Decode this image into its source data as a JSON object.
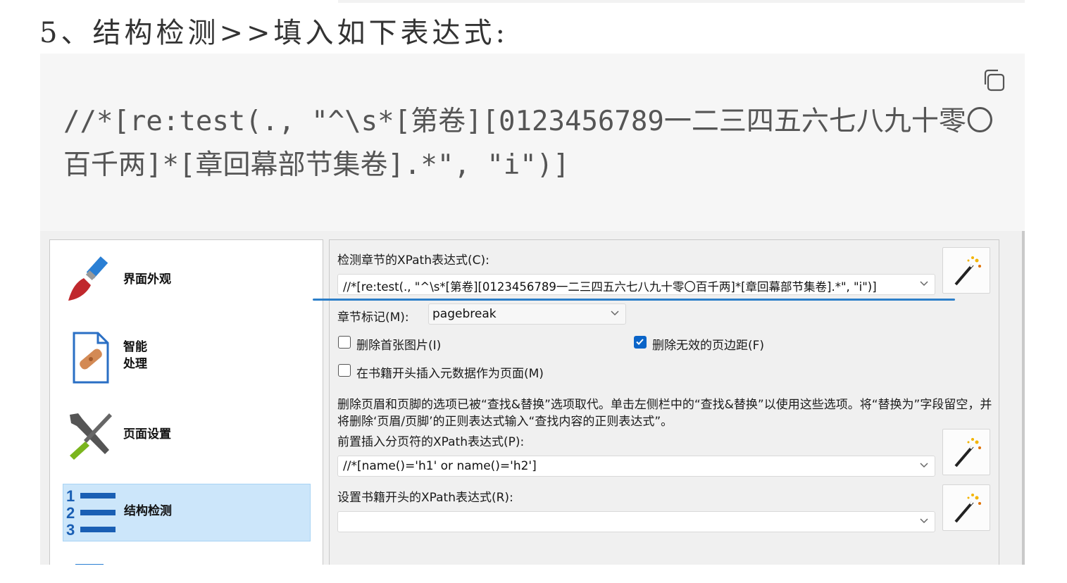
{
  "heading": "5、结构检测>>填入如下表达式:",
  "code": {
    "text": "//*[re:test(., \"^\\s*[第卷][0123456789一二三四五六七八九十零〇百千两]*[章回幕部节集卷].*\", \"i\")]",
    "copy_icon": "copy-icon"
  },
  "sidebar": {
    "items": [
      {
        "label": "界面外观",
        "icon": "paintbrush-icon"
      },
      {
        "label": "智能\n处理",
        "icon": "document-bandage-icon"
      },
      {
        "label": "页面设置",
        "icon": "tools-icon"
      },
      {
        "label": "结构检测",
        "icon": "numbered-list-icon",
        "active": true
      }
    ]
  },
  "main": {
    "chapter_xpath_label": "检测章节的XPath表达式(C):",
    "chapter_xpath_value": "//*[re:test(., \"^\\s*[第卷][0123456789一二三四五六七八九十零〇百千两]*[章回幕部节集卷].*\", \"i\")]",
    "chapter_mark_label": "章节标记(M):",
    "chapter_mark_value": "pagebreak",
    "remove_first_image_label": "删除首张图片(I)",
    "remove_first_image_checked": false,
    "remove_fake_margins_label": "删除无效的页边距(F)",
    "remove_fake_margins_checked": true,
    "insert_metadata_label": "在书籍开头插入元数据作为页面(M)",
    "insert_metadata_checked": false,
    "note": "删除页眉和页脚的选项已被“查找&替换”选项取代。单击左侧栏中的“查找&替换”以使用这些选项。将“替换为”字段留空，并将删除‘页眉/页脚’的正则表达式输入“查找内容的正则表达式”。",
    "page_break_label": "前置插入分页符的XPath表达式(P):",
    "page_break_value": "//*[name()='h1' or name()='h2']",
    "start_reading_label": "设置书籍开头的XPath表达式(R):",
    "start_reading_value": ""
  },
  "colors": {
    "accent": "#0a64c8",
    "active_item_bg": "#cce6fa",
    "underline": "#2d7fc9"
  }
}
